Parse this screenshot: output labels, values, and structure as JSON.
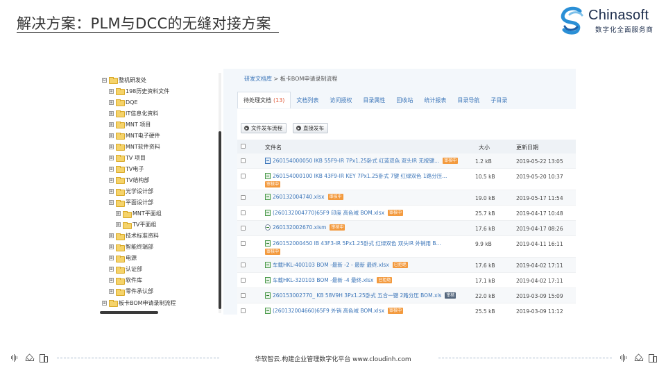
{
  "slide": {
    "title": "解决方案：PLM与DCC的无缝对接方案",
    "logo": {
      "name": "Chinasoft",
      "subtitle": "数字化全面服务商"
    },
    "footer": "华软智云.构建企业管理数字化平台     www.cloudinh.com"
  },
  "tree": {
    "items": [
      {
        "label": "整机研发处",
        "toggle": "⊟",
        "level": 0
      },
      {
        "label": "198历史资料文件",
        "toggle": "⊞",
        "level": 1
      },
      {
        "label": "DQE",
        "toggle": "⊞",
        "level": 1
      },
      {
        "label": "IT信息化资料",
        "toggle": "⊞",
        "level": 1
      },
      {
        "label": "MNT 项目",
        "toggle": "⊞",
        "level": 1
      },
      {
        "label": "MNT电子硬件",
        "toggle": "⊞",
        "level": 1
      },
      {
        "label": "MNT软件资料",
        "toggle": "⊞",
        "level": 1
      },
      {
        "label": "TV 项目",
        "toggle": "⊞",
        "level": 1
      },
      {
        "label": "TV电子",
        "toggle": "⊞",
        "level": 1
      },
      {
        "label": "TV结构部",
        "toggle": "⊞",
        "level": 1
      },
      {
        "label": "光学设计部",
        "toggle": "⊞",
        "level": 1
      },
      {
        "label": "平面设计部",
        "toggle": "⊟",
        "level": 1
      },
      {
        "label": "MNT平面组",
        "toggle": "⊞",
        "level": 2
      },
      {
        "label": "TV平面组",
        "toggle": "⊞",
        "level": 2
      },
      {
        "label": "技术标准资料",
        "toggle": "⊞",
        "level": 1
      },
      {
        "label": "智能终端部",
        "toggle": "⊞",
        "level": 1
      },
      {
        "label": "电源",
        "toggle": "⊞",
        "level": 1
      },
      {
        "label": "认证部",
        "toggle": "⊞",
        "level": 1
      },
      {
        "label": "软件库",
        "toggle": "⊞",
        "level": 1
      },
      {
        "label": "零件承认部",
        "toggle": "⊞",
        "level": 1
      },
      {
        "label": "板卡BOM申请录制流程",
        "toggle": "⊞",
        "level": 0
      }
    ]
  },
  "pane": {
    "breadcrumb": {
      "root": "研发文档库",
      "sep": " > ",
      "current": "板卡BOM申请录制流程"
    },
    "tabs": [
      {
        "label": "待处理文档",
        "count": "(13)",
        "active": true
      },
      {
        "label": "文档列表",
        "count": ""
      },
      {
        "label": "访问授权",
        "count": ""
      },
      {
        "label": "目录属性",
        "count": ""
      },
      {
        "label": "回收站",
        "count": ""
      },
      {
        "label": "统计报表",
        "count": ""
      },
      {
        "label": "目录导航",
        "count": ""
      },
      {
        "label": "子目录",
        "count": ""
      }
    ],
    "buttons": {
      "publish_flow": "文件发布流程",
      "direct_publish": "直接发布"
    },
    "columns": {
      "name": "文件名",
      "size": "大小",
      "date": "更新日期"
    },
    "rows": [
      {
        "name": "260154000050 IKB 55F9-IR 7Px1.25卧式 红蓝双色 双头IR 无按键...",
        "badge": "审核中",
        "badge_style": "orange",
        "icon": "doc",
        "size": "1.2 kB",
        "date": "2019-05-22 13:05",
        "wrap": false
      },
      {
        "name": "260154000100 IKB 43F9-IR KEY 7Px1.25卧式 7键 红绿双色 1路分压...",
        "badge": "审核中",
        "badge_style": "orange",
        "icon": "xls",
        "size": "10.5 kB",
        "date": "2019-05-20 10:37",
        "wrap": true
      },
      {
        "name": "260132004740.xlsx",
        "badge": "审核中",
        "badge_style": "orange",
        "icon": "xls",
        "size": "19.0 kB",
        "date": "2019-05-17 11:54",
        "wrap": false
      },
      {
        "name": "(260132004770)65F9 印度 高色域 BOM.xlsx",
        "badge": "审核中",
        "badge_style": "orange",
        "icon": "xls",
        "size": "25.7 kB",
        "date": "2019-04-17 10:48",
        "wrap": false
      },
      {
        "name": "260132002670.xlsm",
        "badge": "审核中",
        "badge_style": "orange",
        "icon": "circ",
        "size": "17.6 kB",
        "date": "2019-04-17 08:26",
        "wrap": false
      },
      {
        "name": "260152000450 IB 43F3-IR 5Px1.25卧式 红绿双色 双头IR 外销用 B...",
        "badge": "审核中",
        "badge_style": "orange",
        "icon": "xls",
        "size": "9.9 kB",
        "date": "2019-04-11 16:11",
        "wrap": true
      },
      {
        "name": "车载HKL-400103 BOM -最新 -2 - 最新 最终.xlsx",
        "badge": "已拒绝",
        "badge_style": "orange",
        "icon": "xls",
        "size": "17.6 kB",
        "date": "2019-04-02 17:11",
        "wrap": false
      },
      {
        "name": "车载HKL-320103 BOM -最新 -4 最终.xlsx",
        "badge": "已拒绝",
        "badge_style": "orange",
        "icon": "xls",
        "size": "17.1 kB",
        "date": "2019-04-02 17:11",
        "wrap": false
      },
      {
        "name": "260153002770_ KB 58V9H 3Px1.25卧式 五合一键 2路分压 BOM.xls",
        "badge": "审核",
        "badge_style": "dark",
        "icon": "xls",
        "size": "22.0 kB",
        "date": "2019-03-09 15:09",
        "wrap": false
      },
      {
        "name": "(260132004660)65F9 外销 高色域 BOM.xlsx",
        "badge": "审核中",
        "badge_style": "orange",
        "icon": "xls",
        "size": "25.5 kB",
        "date": "2019-03-09 11:12",
        "wrap": false
      }
    ]
  }
}
